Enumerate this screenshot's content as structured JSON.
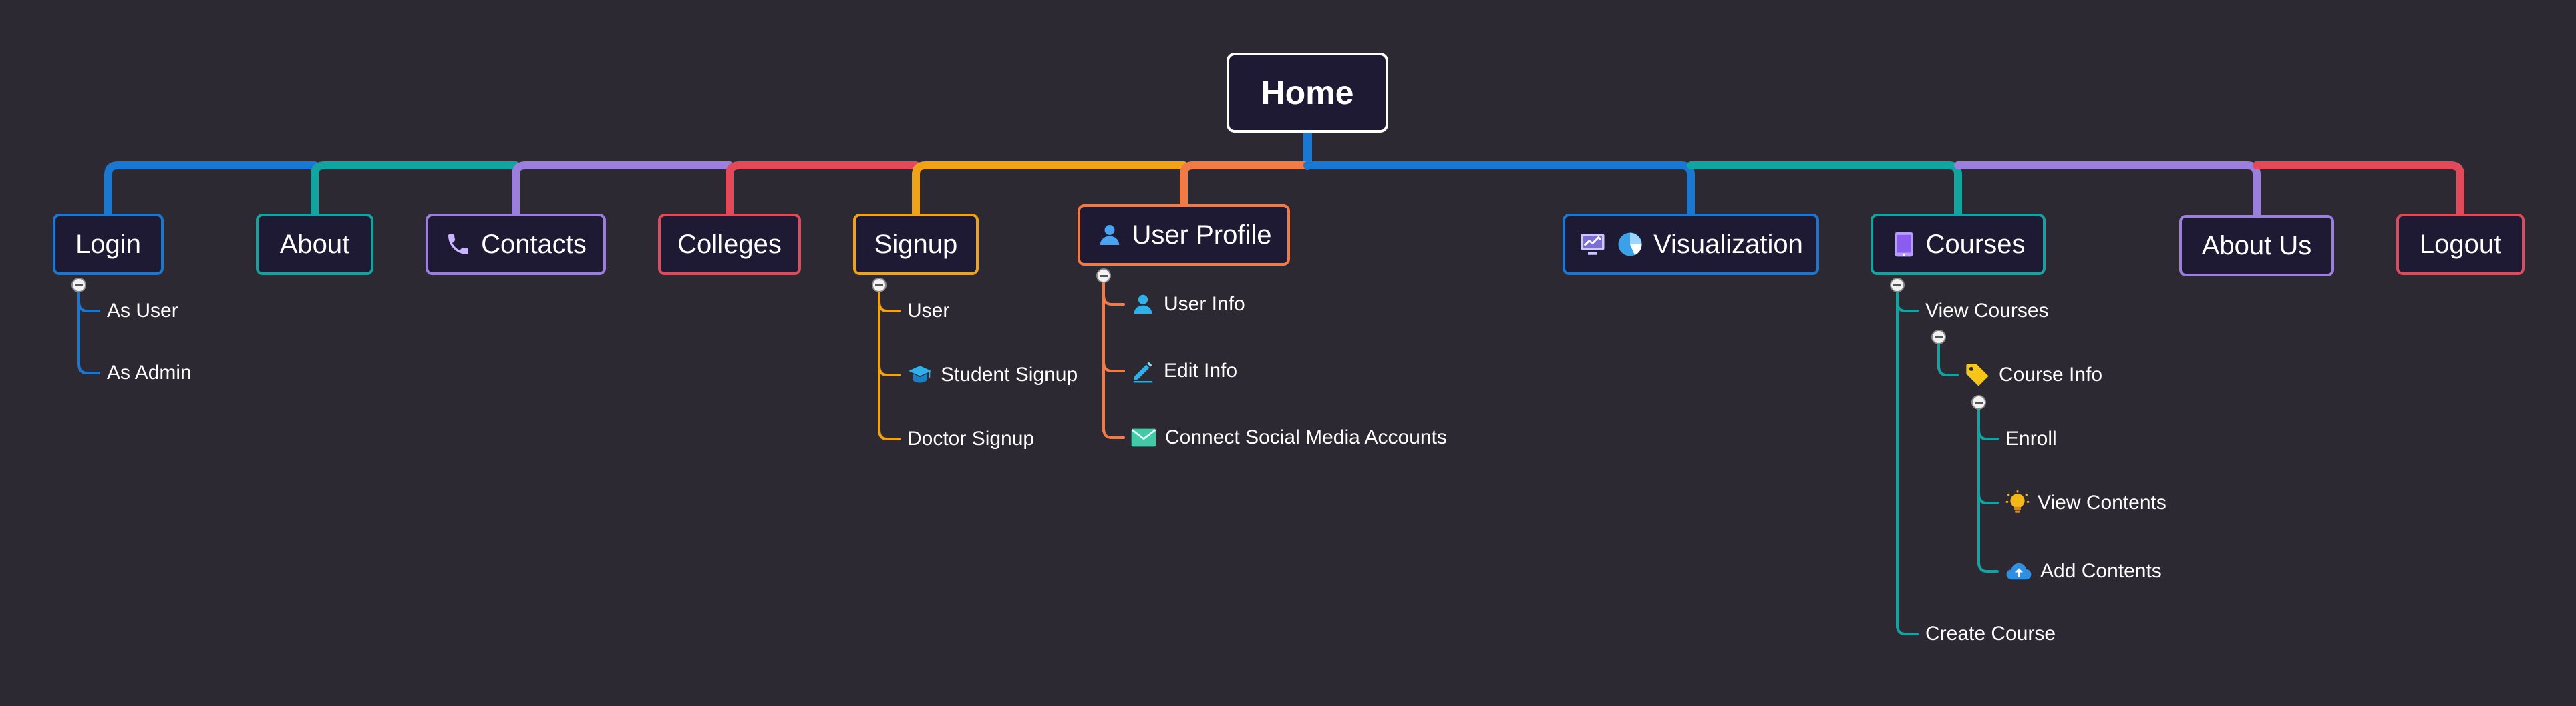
{
  "root": {
    "label": "Home"
  },
  "branches": [
    {
      "id": "login",
      "label": "Login",
      "color": "#1a78d2",
      "children": [
        {
          "label": "As User"
        },
        {
          "label": "As Admin"
        }
      ]
    },
    {
      "id": "about",
      "label": "About",
      "color": "#12a4a0"
    },
    {
      "id": "contacts",
      "label": "Contacts",
      "color": "#9b7fdc",
      "icon": "phone-icon"
    },
    {
      "id": "colleges",
      "label": "Colleges",
      "color": "#e24a5a"
    },
    {
      "id": "signup",
      "label": "Signup",
      "color": "#f0a318",
      "children": [
        {
          "label": "User"
        },
        {
          "label": "Student Signup",
          "icon": "graduation-cap-icon"
        },
        {
          "label": "Doctor Signup"
        }
      ]
    },
    {
      "id": "user-profile",
      "label": "User Profile",
      "color": "#f07b46",
      "icon": "user-icon",
      "children": [
        {
          "label": "User Info",
          "icon": "user-icon"
        },
        {
          "label": "Edit Info",
          "icon": "pencil-icon"
        },
        {
          "label": "Connect Social Media Accounts",
          "icon": "envelope-icon"
        }
      ]
    },
    {
      "id": "visualization",
      "label": "Visualization",
      "color": "#1a78d2",
      "icons": [
        "chart-monitor-icon",
        "pie-chart-icon"
      ]
    },
    {
      "id": "courses",
      "label": "Courses",
      "color": "#12a4a0",
      "icon": "tablet-icon",
      "children": [
        {
          "label": "View Courses",
          "children": [
            {
              "label": "Course Info",
              "icon": "tag-icon",
              "children": [
                {
                  "label": "Enroll"
                },
                {
                  "label": "View Contents",
                  "icon": "lightbulb-icon"
                },
                {
                  "label": "Add Contents",
                  "icon": "cloud-upload-icon"
                }
              ]
            }
          ]
        },
        {
          "label": "Create Course"
        }
      ]
    },
    {
      "id": "about-us",
      "label": "About Us",
      "color": "#9b7fdc"
    },
    {
      "id": "logout",
      "label": "Logout",
      "color": "#e24a5a"
    }
  ]
}
